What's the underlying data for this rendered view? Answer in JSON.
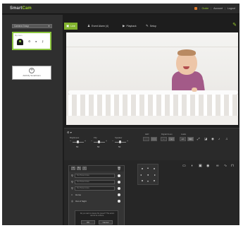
{
  "app": {
    "brand": "Smart",
    "brand_accent": "Cam",
    "accent_color": "#82b32e"
  },
  "header": {
    "links": [
      "Guide",
      "Account",
      "Logout"
    ]
  },
  "sidebar": {
    "group_select": "Camera Group",
    "camera": {
      "name": "My Cam"
    },
    "add_camera_label": "Add My SmartCam"
  },
  "tabs": [
    "Live",
    "Event Alarm (4)",
    "Playback",
    "Setup"
  ],
  "controls": {
    "sliders": [
      {
        "label": "Brightness",
        "value": "50"
      },
      {
        "label": "Flip",
        "value": "50"
      },
      {
        "label": "Speaker",
        "value": "50"
      }
    ],
    "groups": [
      "LED",
      "Digital Zoom",
      "Audio"
    ],
    "resolution_buttons": [
      "HD",
      "SD"
    ]
  },
  "presets": {
    "fields": [
      "No Preset Area",
      "No Preset Area",
      "No Preset Area"
    ],
    "options": [
      "Home",
      "Out of Sight"
    ],
    "confirm_message": "Do you want to delete this preset? This action cannot be undone.",
    "buttons": [
      "OK",
      "Cancel"
    ]
  }
}
